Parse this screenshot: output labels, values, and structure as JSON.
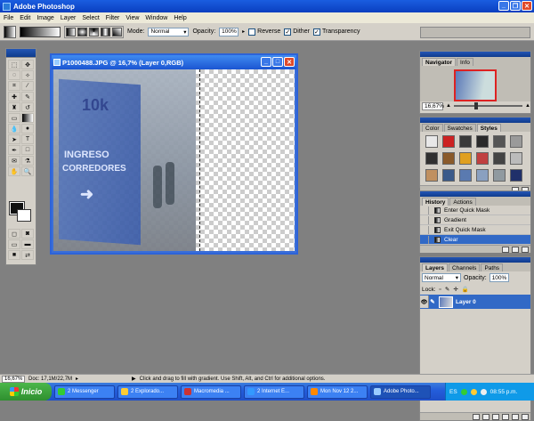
{
  "app": {
    "title": "Adobe Photoshop"
  },
  "menu": [
    "File",
    "Edit",
    "Image",
    "Layer",
    "Select",
    "Filter",
    "View",
    "Window",
    "Help"
  ],
  "options": {
    "mode_label": "Mode:",
    "mode_value": "Normal",
    "opacity_label": "Opacity:",
    "opacity_value": "100%",
    "reverse": "Reverse",
    "dither": "Dither",
    "transparency": "Transparency"
  },
  "document": {
    "title": "P1000488.JPG @ 16,7% (Layer 0,RGB)"
  },
  "photo_text": {
    "brand": "10k",
    "line1": "INGRESO",
    "line2": "CORREDORES",
    "arrow": "➜"
  },
  "navigator": {
    "tabs": [
      "Navigator",
      "Info"
    ],
    "zoom": "16,67%"
  },
  "styles": {
    "tabs": [
      "Color",
      "Swatches",
      "Styles"
    ],
    "colors": [
      "#e8e8e8",
      "#cc2222",
      "#3a3a3a",
      "#2a2a2a",
      "#555555",
      "#9a9a9a",
      "#303030",
      "#8a5a2a",
      "#e0a020",
      "#c04040",
      "#444444",
      "#bbbbbb",
      "#c09060",
      "#3a5a8a",
      "#5a7ab0",
      "#8aa0c0",
      "#909aa0",
      "#20306a"
    ]
  },
  "history": {
    "tabs": [
      "History",
      "Actions"
    ],
    "items": [
      "Enter Quick Mask",
      "Gradient",
      "Exit Quick Mask",
      "Clear"
    ]
  },
  "layers": {
    "tabs": [
      "Layers",
      "Channels",
      "Paths"
    ],
    "blend": "Normal",
    "opacity_label": "Opacity:",
    "opacity_value": "100%",
    "lock_label": "Lock:",
    "layer_name": "Layer 0"
  },
  "status": {
    "zoom": "16,67%",
    "doc": "Doc: 17,1M/22,7M",
    "hint": "Click and drag to fill with gradient. Use Shift, Alt, and Ctrl for additional options."
  },
  "taskbar": {
    "start": "Inicio",
    "tasks": [
      "2 Messenger",
      "2 Explorado...",
      "Macromedia ...",
      "2 Internet E...",
      "Mon Nov 12 2...",
      "Adobe Photo..."
    ],
    "lang": "ES",
    "clock": "08:55 p.m."
  }
}
